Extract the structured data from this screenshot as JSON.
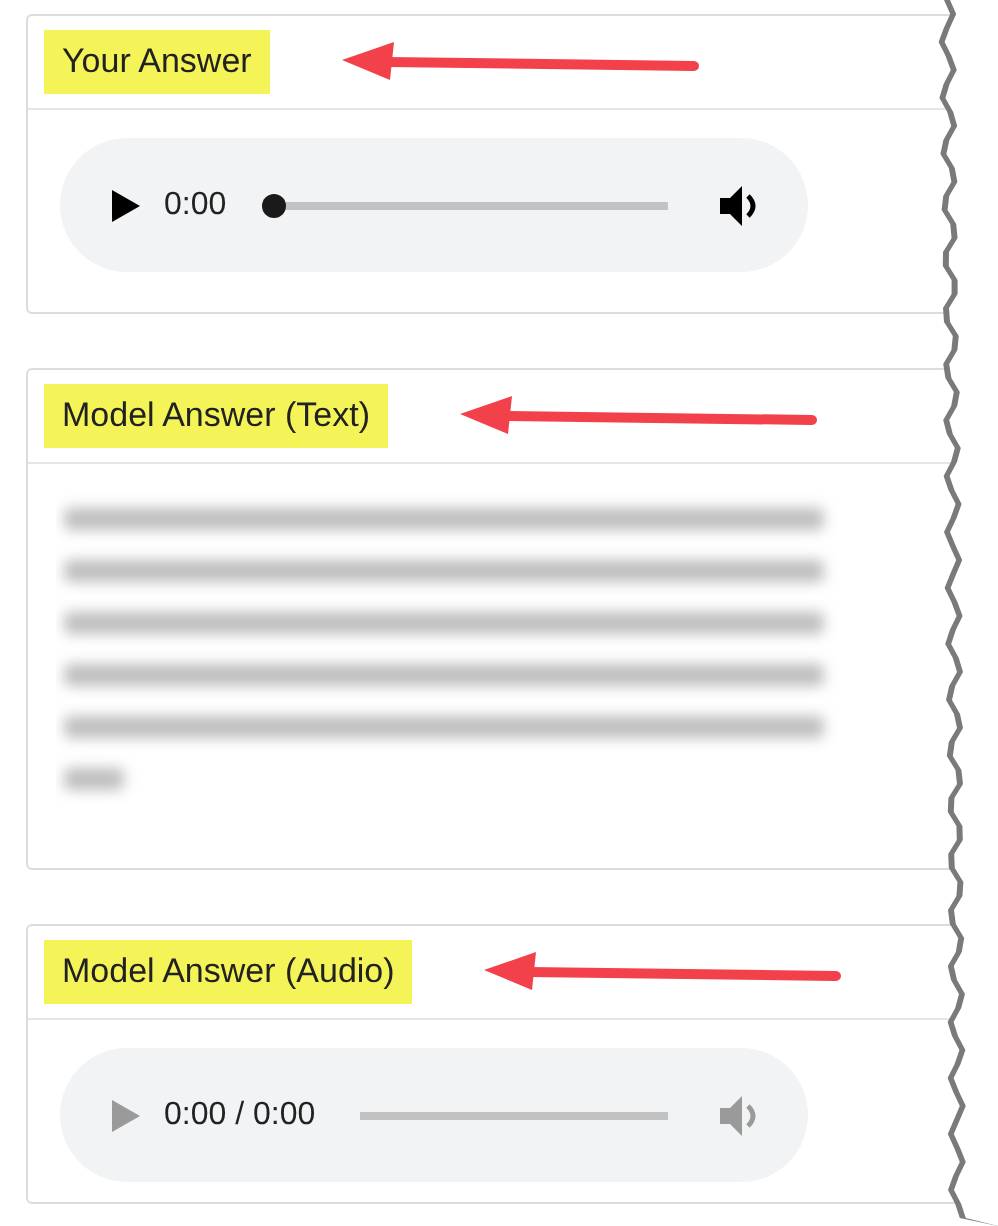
{
  "sections": [
    {
      "title": "Your Answer",
      "highlighted": true,
      "kind": "audio",
      "time": "0:00",
      "level": 0,
      "disabled": false
    },
    {
      "title": "Model Answer (Text)",
      "highlighted": true,
      "kind": "text"
    },
    {
      "title": "Model Answer (Audio)",
      "highlighted": true,
      "kind": "audio",
      "time": "0:00 / 0:00",
      "disabled": true
    }
  ]
}
